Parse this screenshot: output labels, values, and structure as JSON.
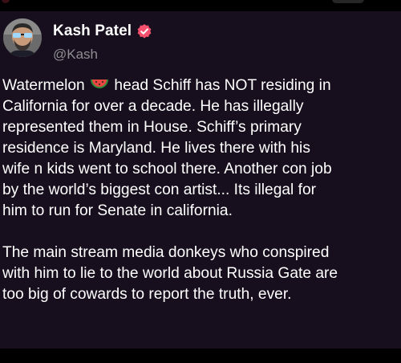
{
  "author": {
    "display_name": "Kash Patel",
    "handle": "@Kash",
    "verified": true
  },
  "post": {
    "paragraph1": {
      "line1_before_emoji": "Watermelon",
      "emoji": "watermelon-emoji",
      "line1_after_emoji": "head Schiff has NOT residing in",
      "line2": "California for over a decade. He has illegally",
      "line3": "represented them in House. Schiff’s primary",
      "line4": "residence is Maryland. He lives there with his",
      "line5": "wife n kids went to school there. Another con job",
      "line6": "by the world’s biggest con artist... Its illegal for",
      "line7": "him to run for Senate in california."
    },
    "paragraph2": {
      "line1": "The main stream media donkeys who conspired",
      "line2": "with him to lie to the world about Russia Gate are",
      "line3": "too big of cowards to report the truth, ever."
    }
  },
  "theme": {
    "page_background": "#000000",
    "post_background": "#170f1d",
    "text_color": "#ffffff",
    "handle_color": "#8e8e93",
    "verified_color": "#f5506d"
  },
  "icons": {
    "avatar": "profile-photo",
    "verified": "verified-badge-icon"
  }
}
